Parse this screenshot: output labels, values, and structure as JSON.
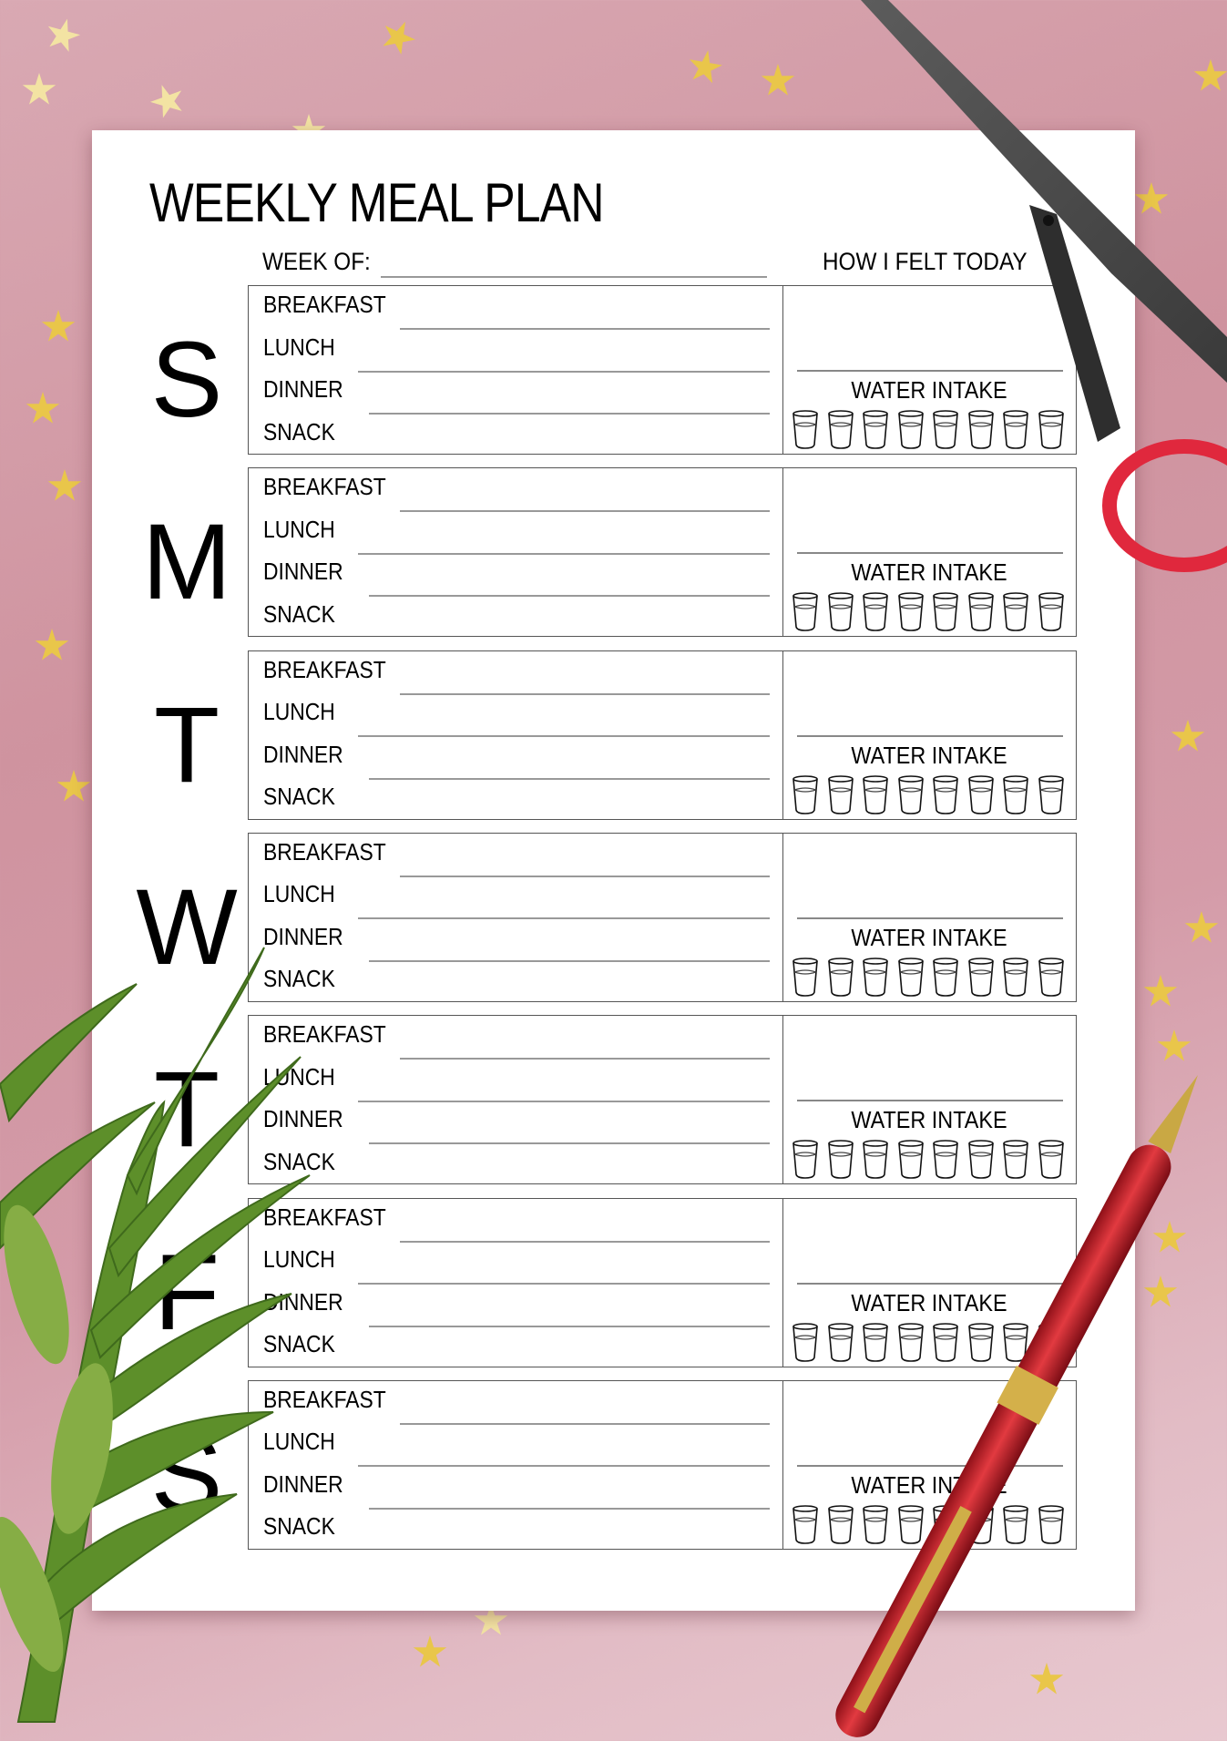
{
  "planner": {
    "title": "WEEKLY MEAL PLAN",
    "week_of_label": "WEEK OF:",
    "week_of_value": "",
    "felt_header": "HOW I FELT TODAY",
    "water_label": "WATER INTAKE",
    "glasses_per_day": 8,
    "meal_labels": [
      "BREAKFAST",
      "LUNCH",
      "DINNER",
      "SNACK"
    ],
    "days": [
      {
        "letter": "S"
      },
      {
        "letter": "M"
      },
      {
        "letter": "T"
      },
      {
        "letter": "W"
      },
      {
        "letter": "T"
      },
      {
        "letter": "F"
      },
      {
        "letter": "S"
      }
    ]
  },
  "decorations": {
    "background": "pink-paper-with-gold-stars",
    "objects": [
      "scissors",
      "red-pen",
      "green-plant"
    ]
  },
  "colors": {
    "background": "#d49ba8",
    "star": "#e9c64a",
    "paper": "#ffffff",
    "ink": "#000000",
    "rule": "#999999",
    "scissors_handle": "#e0283d",
    "pen_body": "#c0202a",
    "pen_trim": "#d4b04a",
    "leaf": "#5d8f2a"
  }
}
